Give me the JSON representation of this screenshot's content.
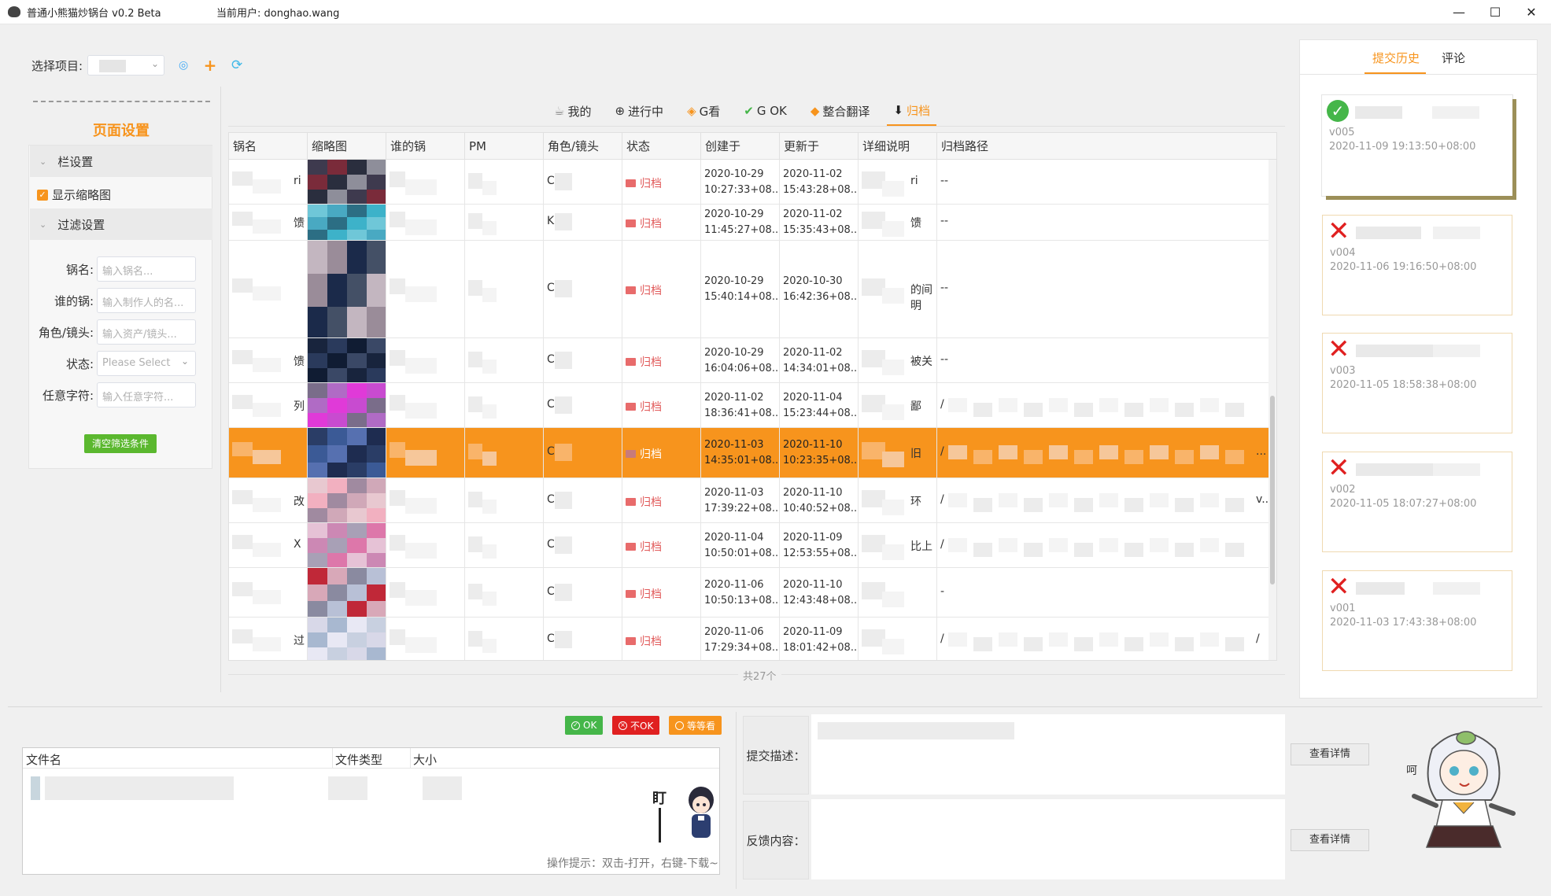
{
  "window": {
    "app_title": "普通小熊猫炒锅台 v0.2 Beta",
    "current_user": "当前用户: donghao.wang",
    "controls": [
      "—",
      "☐",
      "✕"
    ]
  },
  "project": {
    "label": "选择项目:"
  },
  "page_settings": {
    "title": "页面设置",
    "column_section": "栏设置",
    "show_thumbnail": "显示缩略图",
    "filter_section": "过滤设置",
    "filters": [
      {
        "label": "锅名:",
        "placeholder": "输入锅名..."
      },
      {
        "label": "谁的锅:",
        "placeholder": "输入制作人的名..."
      },
      {
        "label": "角色/镜头:",
        "placeholder": "输入资产/镜头..."
      },
      {
        "label": "状态:",
        "placeholder": "Please Select"
      },
      {
        "label": "任意字符:",
        "placeholder": "输入任意字符..."
      }
    ],
    "clear_button": "清空筛选条件"
  },
  "tabs": [
    {
      "label": "我的",
      "icon": "mine-icon"
    },
    {
      "label": "进行中",
      "icon": "in-progress-icon"
    },
    {
      "label": "G看",
      "icon": "g-review-icon"
    },
    {
      "label": "G OK",
      "icon": "check-icon"
    },
    {
      "label": "整合翻译",
      "icon": "layers-icon"
    },
    {
      "label": "归档",
      "icon": "archive-icon",
      "active": true
    }
  ],
  "table": {
    "columns": [
      "锅名",
      "缩略图",
      "谁的锅",
      "PM",
      "角色/镜头",
      "状态",
      "创建于",
      "更新于",
      "详细说明",
      "归档路径"
    ],
    "rows": [
      {
        "name_tail": "ri",
        "role": "C",
        "status": "归档",
        "created": [
          "2020-10-29",
          "10:27:33+08..."
        ],
        "updated": [
          "2020-11-02",
          "15:43:28+08..."
        ],
        "detail": "ri",
        "path": "--"
      },
      {
        "name_tail": "馈",
        "role": "K",
        "status": "归档",
        "created": [
          "2020-10-29",
          "11:45:27+08..."
        ],
        "updated": [
          "2020-11-02",
          "15:35:43+08..."
        ],
        "detail": "馈",
        "path": "--"
      },
      {
        "name_tail": "",
        "role": "C",
        "status": "归档",
        "created": [
          "2020-10-29",
          "15:40:14+08..."
        ],
        "updated": [
          "2020-10-30",
          "16:42:36+08..."
        ],
        "detail": "的间明",
        "path": "--"
      },
      {
        "name_tail": "馈",
        "role": "C",
        "status": "归档",
        "created": [
          "2020-10-29",
          "16:04:06+08..."
        ],
        "updated": [
          "2020-11-02",
          "14:34:01+08..."
        ],
        "detail": "被关",
        "path": "--"
      },
      {
        "name_tail": "列",
        "role": "C",
        "status": "归档",
        "created": [
          "2020-11-02",
          "18:36:41+08..."
        ],
        "updated": [
          "2020-11-04",
          "15:23:44+08..."
        ],
        "detail": "鄙",
        "path": "/"
      },
      {
        "name_tail": "",
        "role": "C",
        "status": "归档",
        "created": [
          "2020-11-03",
          "14:35:01+08..."
        ],
        "updated": [
          "2020-11-10",
          "10:23:35+08..."
        ],
        "detail": "旧",
        "path": "/",
        "path_tail": "...",
        "selected": true
      },
      {
        "name_tail": "改",
        "role": "C",
        "status": "归档",
        "created": [
          "2020-11-03",
          "17:39:22+08..."
        ],
        "updated": [
          "2020-11-10",
          "10:40:52+08..."
        ],
        "detail": "环",
        "path": "/",
        "path_tail": "v..."
      },
      {
        "name_tail": "X",
        "role": "C",
        "status": "归档",
        "created": [
          "2020-11-04",
          "10:50:01+08..."
        ],
        "updated": [
          "2020-11-09",
          "12:53:55+08..."
        ],
        "detail": "比上",
        "path": "/"
      },
      {
        "name_tail": "",
        "role": "C",
        "status": "归档",
        "created": [
          "2020-11-06",
          "10:50:13+08..."
        ],
        "updated": [
          "2020-11-10",
          "12:43:48+08..."
        ],
        "detail": "",
        "path": "-"
      },
      {
        "name_tail": "过",
        "role": "C",
        "status": "归档",
        "created": [
          "2020-11-06",
          "17:29:34+08..."
        ],
        "updated": [
          "2020-11-09",
          "18:01:42+08..."
        ],
        "detail": "",
        "path": "/",
        "path_tail": "/"
      }
    ],
    "total": "共27个"
  },
  "history": {
    "tab_history": "提交历史",
    "tab_comments": "评论",
    "items": [
      {
        "version": "v005",
        "time": "2020-11-09 19:13:50+08:00",
        "result": "ok"
      },
      {
        "version": "v004",
        "time": "2020-11-06 19:16:50+08:00",
        "result": "rejected"
      },
      {
        "version": "v003",
        "time": "2020-11-05 18:58:38+08:00",
        "result": "rejected"
      },
      {
        "version": "v002",
        "time": "2020-11-05 18:07:27+08:00",
        "result": "rejected"
      },
      {
        "version": "v001",
        "time": "2020-11-03 17:43:38+08:00",
        "result": "rejected"
      }
    ]
  },
  "review_buttons": {
    "ok": "OK",
    "not_ok": "不OK",
    "wait": "等等看"
  },
  "files": {
    "columns": [
      "文件名",
      "文件类型",
      "大小"
    ],
    "stare_text": "盯",
    "hint": "操作提示：双击-打开，右键-下载~"
  },
  "submit_desc_label": "提交描述：",
  "feedback_label": "反馈内容：",
  "detail_button": "查看详情",
  "colors": {
    "accent": "#f7941d",
    "ok": "#45b649",
    "reject": "#e02020",
    "wait": "#f7941d"
  }
}
